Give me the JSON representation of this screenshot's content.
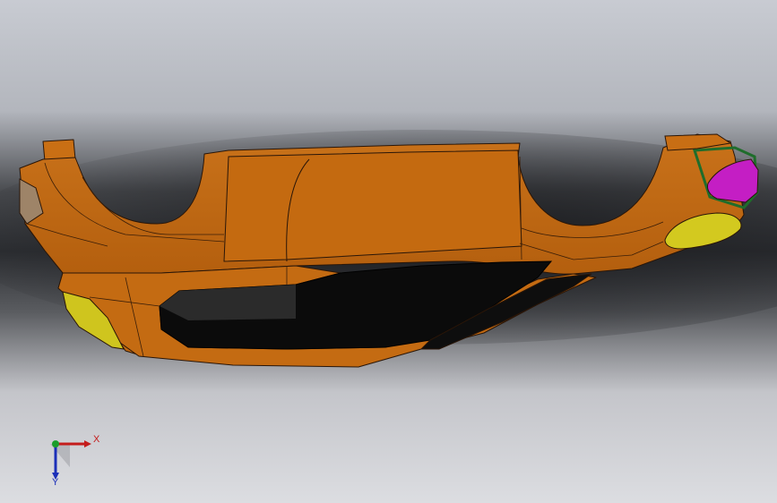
{
  "viewport": {
    "background_top": "#c9ccd3",
    "background_mid": "#3f4145",
    "background_bottom": "#d6d7db",
    "model_color": "#c26a12",
    "model_edge_color": "#2a1608",
    "lamp_yellow": "#cfc51e",
    "accent_magenta": "#c41ec4",
    "accent_green": "#1f6d2b",
    "underside_black": "#0b0b0b"
  },
  "triad": {
    "x_label": "X",
    "y_label": "Y",
    "x_color": "#c41c1c",
    "y_color": "#1b9e2b",
    "z_color": "#1b2fb8"
  }
}
